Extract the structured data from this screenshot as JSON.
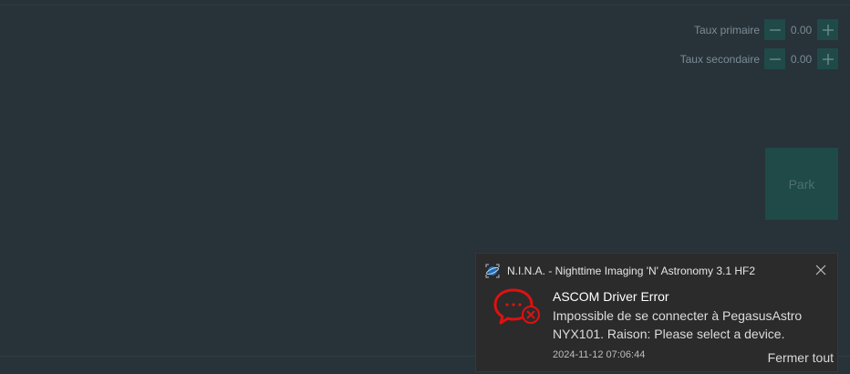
{
  "rates": {
    "primary": {
      "label": "Taux primaire",
      "value": "0.00"
    },
    "secondary": {
      "label": "Taux secondaire",
      "value": "0.00"
    }
  },
  "park": {
    "label": "Park"
  },
  "notification": {
    "app_name": "N.I.N.A. - Nighttime Imaging 'N' Astronomy 3.1 HF2",
    "title": "ASCOM Driver Error",
    "message": "Impossible de se connecter à PegasusAstro NYX101. Raison: Please select a device.",
    "timestamp": "2024-11-12 07:06:44",
    "action_label": "Fermer tout"
  },
  "colors": {
    "background": "#273239",
    "button": "#1f4a48",
    "error_red": "#e01010",
    "toast_bg": "#2b2b2b"
  },
  "icons": {
    "minus": "minus-icon",
    "plus": "plus-icon",
    "close": "close-icon",
    "app": "nina-app-icon",
    "error": "error-chat-icon"
  }
}
